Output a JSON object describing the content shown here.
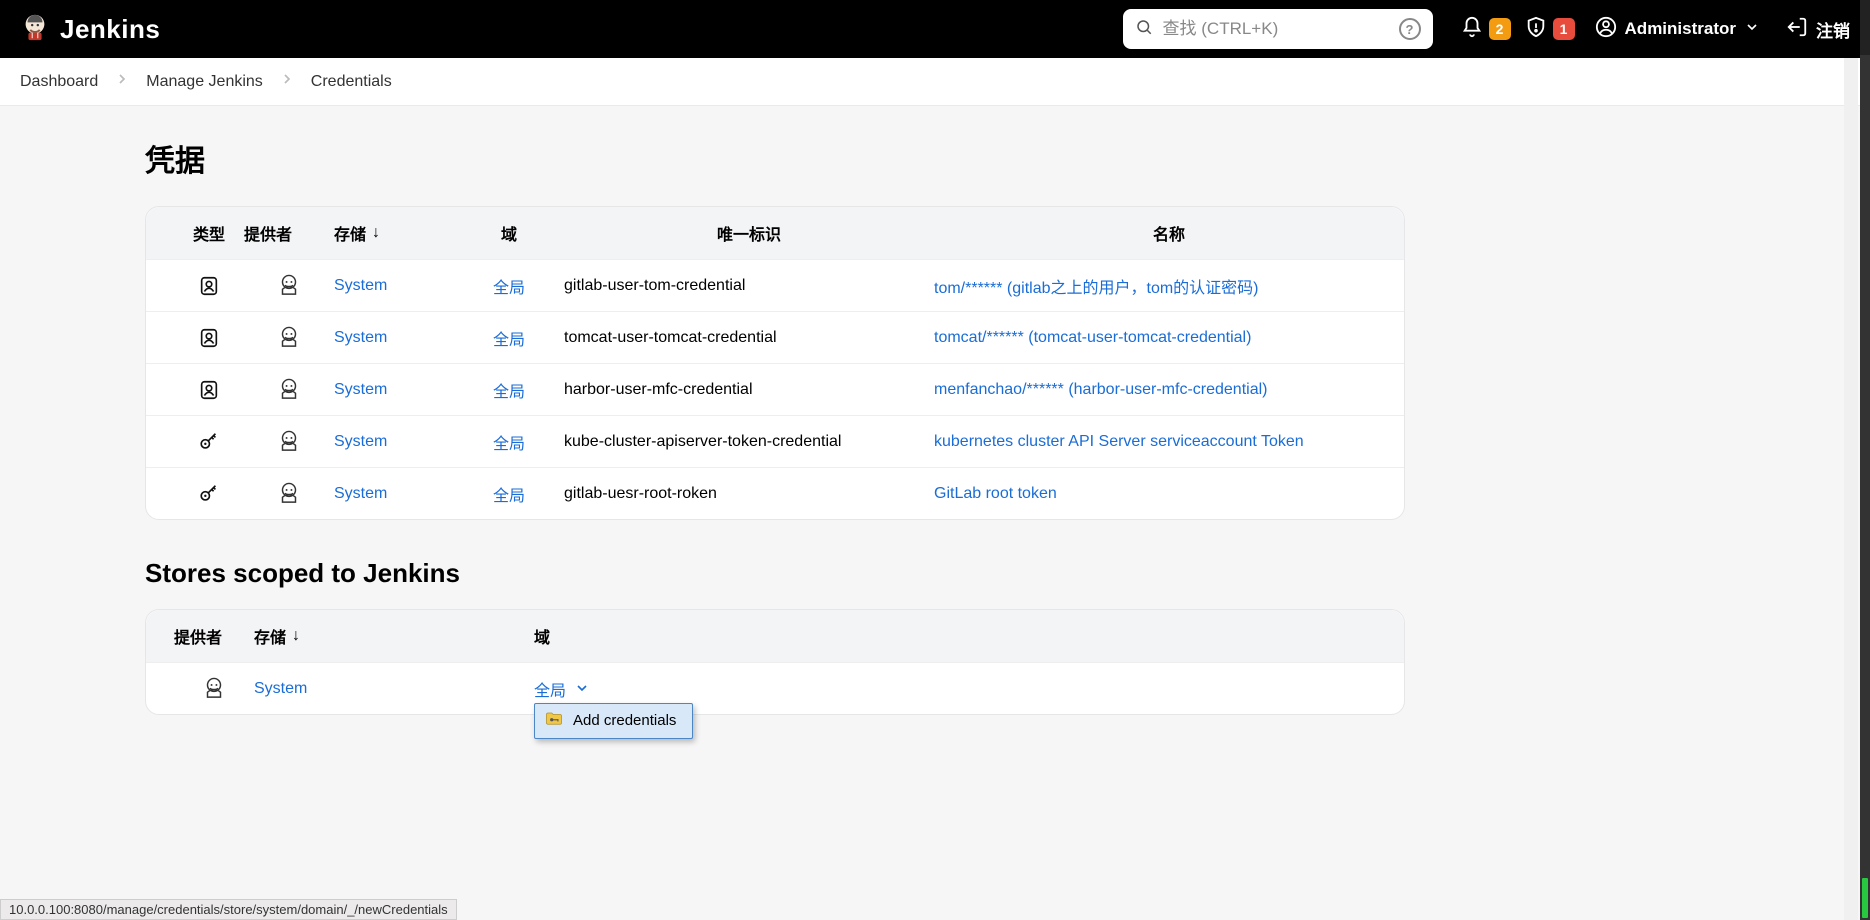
{
  "brand": {
    "name": "Jenkins"
  },
  "search": {
    "placeholder": "查找 (CTRL+K)"
  },
  "header": {
    "notif_count": "2",
    "alert_count": "1",
    "user": "Administrator",
    "logout": "注销"
  },
  "breadcrumbs": {
    "items": [
      "Dashboard",
      "Manage Jenkins",
      "Credentials"
    ]
  },
  "page_title": "凭据",
  "cred_table": {
    "headers": {
      "type": "类型",
      "provider": "提供者",
      "store": "存储",
      "sort_indicator": "↓",
      "domain": "域",
      "id": "唯一标识",
      "name": "名称"
    },
    "rows": [
      {
        "icon": "user-card",
        "store": "System",
        "domain": "全局",
        "id": "gitlab-user-tom-credential",
        "name": "tom/****** (gitlab之上的用户，tom的认证密码)"
      },
      {
        "icon": "user-card",
        "store": "System",
        "domain": "全局",
        "id": "tomcat-user-tomcat-credential",
        "name": "tomcat/****** (tomcat-user-tomcat-credential)"
      },
      {
        "icon": "user-card",
        "store": "System",
        "domain": "全局",
        "id": "harbor-user-mfc-credential",
        "name": "menfanchao/****** (harbor-user-mfc-credential)"
      },
      {
        "icon": "key",
        "store": "System",
        "domain": "全局",
        "id": "kube-cluster-apiserver-token-credential",
        "name": "kubernetes cluster API Server serviceaccount Token"
      },
      {
        "icon": "key",
        "store": "System",
        "domain": "全局",
        "id": "gitlab-uesr-root-roken",
        "name": "GitLab root token"
      }
    ]
  },
  "stores_title": "Stores scoped to Jenkins",
  "stores_table": {
    "headers": {
      "provider": "提供者",
      "store": "存储",
      "sort_indicator": "↓",
      "domain": "域"
    },
    "rows": [
      {
        "store": "System",
        "domain": "全局"
      }
    ]
  },
  "context_menu": {
    "add_credentials": "Add credentials"
  },
  "statusbar": {
    "text": "10.0.0.100:8080/manage/credentials/store/system/domain/_/newCredentials"
  }
}
